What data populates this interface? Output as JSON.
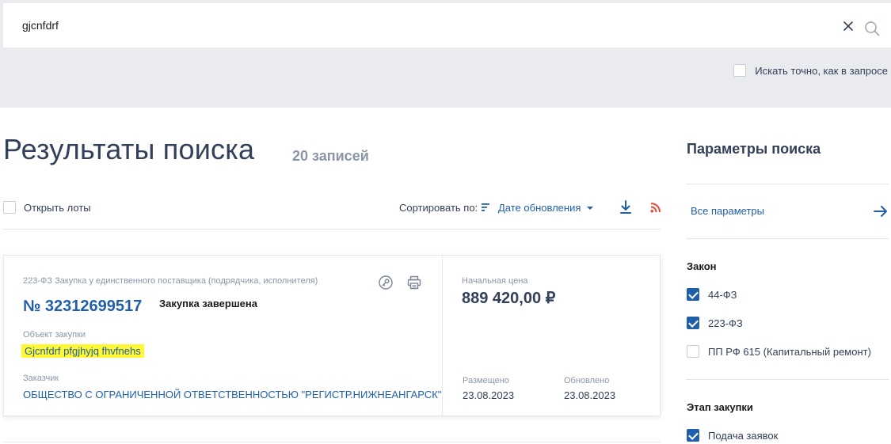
{
  "search": {
    "query": "gjcnfdrf",
    "exact_label": "Искать точно, как в запросе",
    "exact_checked": false
  },
  "results": {
    "title": "Результаты поиска",
    "count": "20 записей",
    "open_lots_label": "Открыть лоты",
    "sort_label": "Сортировать по:",
    "sort_value": "Дате обновления"
  },
  "card": {
    "type": "223-ФЗ Закупка у единственного поставщика (подрядчика, исполнителя)",
    "number": "№ 32312699517",
    "status": "Закупка завершена",
    "object_label": "Объект закупки",
    "object_value": "Gjcnfdrf pfgjhyjq fhvfnehs",
    "customer_label": "Заказчик",
    "customer_value": "ОБЩЕСТВО С ОГРАНИЧЕННОЙ ОТВЕТСТВЕННОСТЬЮ \"РЕГИСТР.НИЖНЕАНГАРСК\"",
    "price_label": "Начальная цена",
    "price_value": "889 420,00 ₽",
    "posted_label": "Размещено",
    "posted_value": "23.08.2023",
    "updated_label": "Обновлено",
    "updated_value": "23.08.2023"
  },
  "panel": {
    "title": "Параметры поиска",
    "all_params": "Все параметры",
    "law_heading": "Закон",
    "law_items": [
      {
        "label": "44-ФЗ",
        "checked": true
      },
      {
        "label": "223-ФЗ",
        "checked": true
      },
      {
        "label": "ПП РФ 615 (Капитальный ремонт)",
        "checked": false
      }
    ],
    "stage_heading": "Этап закупки",
    "stage_items": [
      {
        "label": "Подача заявок",
        "checked": true
      }
    ]
  },
  "colors": {
    "accent": "#1f5faa",
    "highlight": "#fff833",
    "rss": "#e8452c",
    "band": "#e9ebee"
  },
  "icons": [
    "close-icon",
    "search-icon",
    "sort-icon",
    "chevron-down-icon",
    "download-icon",
    "rss-icon",
    "key-icon",
    "print-icon",
    "arrow-right-icon"
  ]
}
